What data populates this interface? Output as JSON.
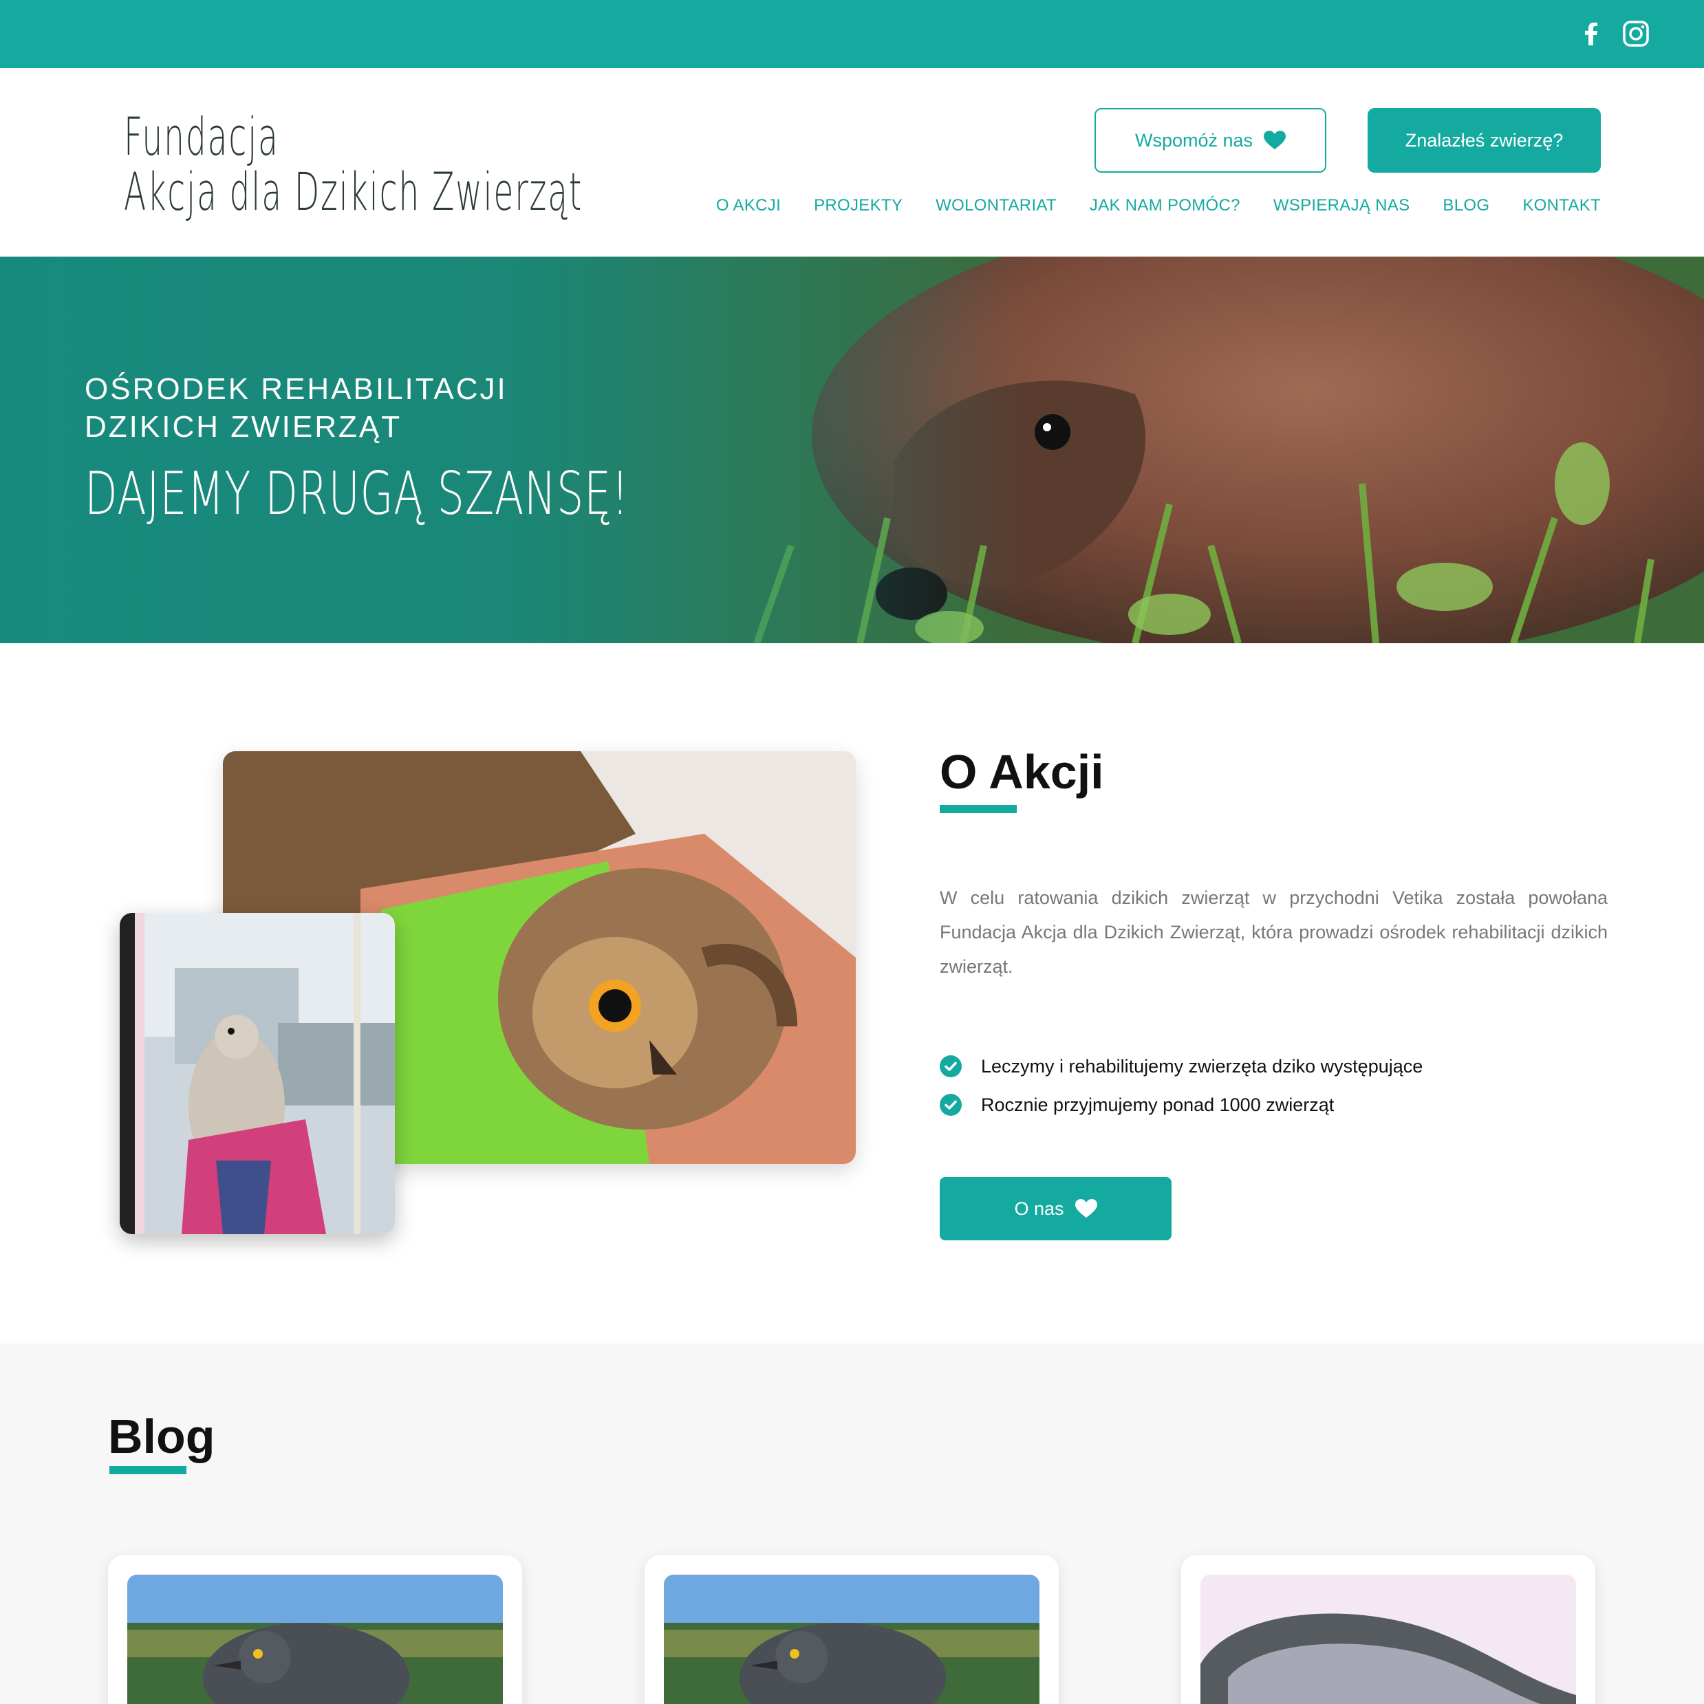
{
  "topbar": {
    "social": [
      {
        "icon": "facebook-icon"
      },
      {
        "icon": "instagram-icon"
      }
    ]
  },
  "header": {
    "logo_line1": "Fundacja",
    "logo_line2": "Akcja dla Dzikich Zwierząt",
    "support_button": "Wspomóż nas",
    "found_button": "Znalazłeś zwierzę?",
    "nav": [
      "O AKCJI",
      "PROJEKTY",
      "WOLONTARIAT",
      "JAK NAM POMÓC?",
      "WSPIERAJĄ NAS",
      "BLOG",
      "KONTAKT"
    ]
  },
  "hero": {
    "subtitle_line1": "OŚRODEK REHABILITACJI",
    "subtitle_line2": "DZIKICH ZWIERZĄT",
    "title": "DAJEMY DRUGĄ SZANSĘ!"
  },
  "about": {
    "title": "O Akcji",
    "description": "W celu ratowania dzikich zwierząt w przychodni Vetika została powołana Fundacja Akcja dla Dzikich Zwierząt, która prowadzi ośrodek rehabilitacji dzikich zwierząt.",
    "bullets": [
      "Leczymy i rehabilitujemy zwierzęta dziko występujące",
      "Rocznie przyjmujemy ponad 1000 zwierząt"
    ],
    "button": "O nas"
  },
  "blog": {
    "title": "Blog"
  },
  "colors": {
    "accent": "#15aaa0",
    "dark": "#2c3a3a"
  }
}
